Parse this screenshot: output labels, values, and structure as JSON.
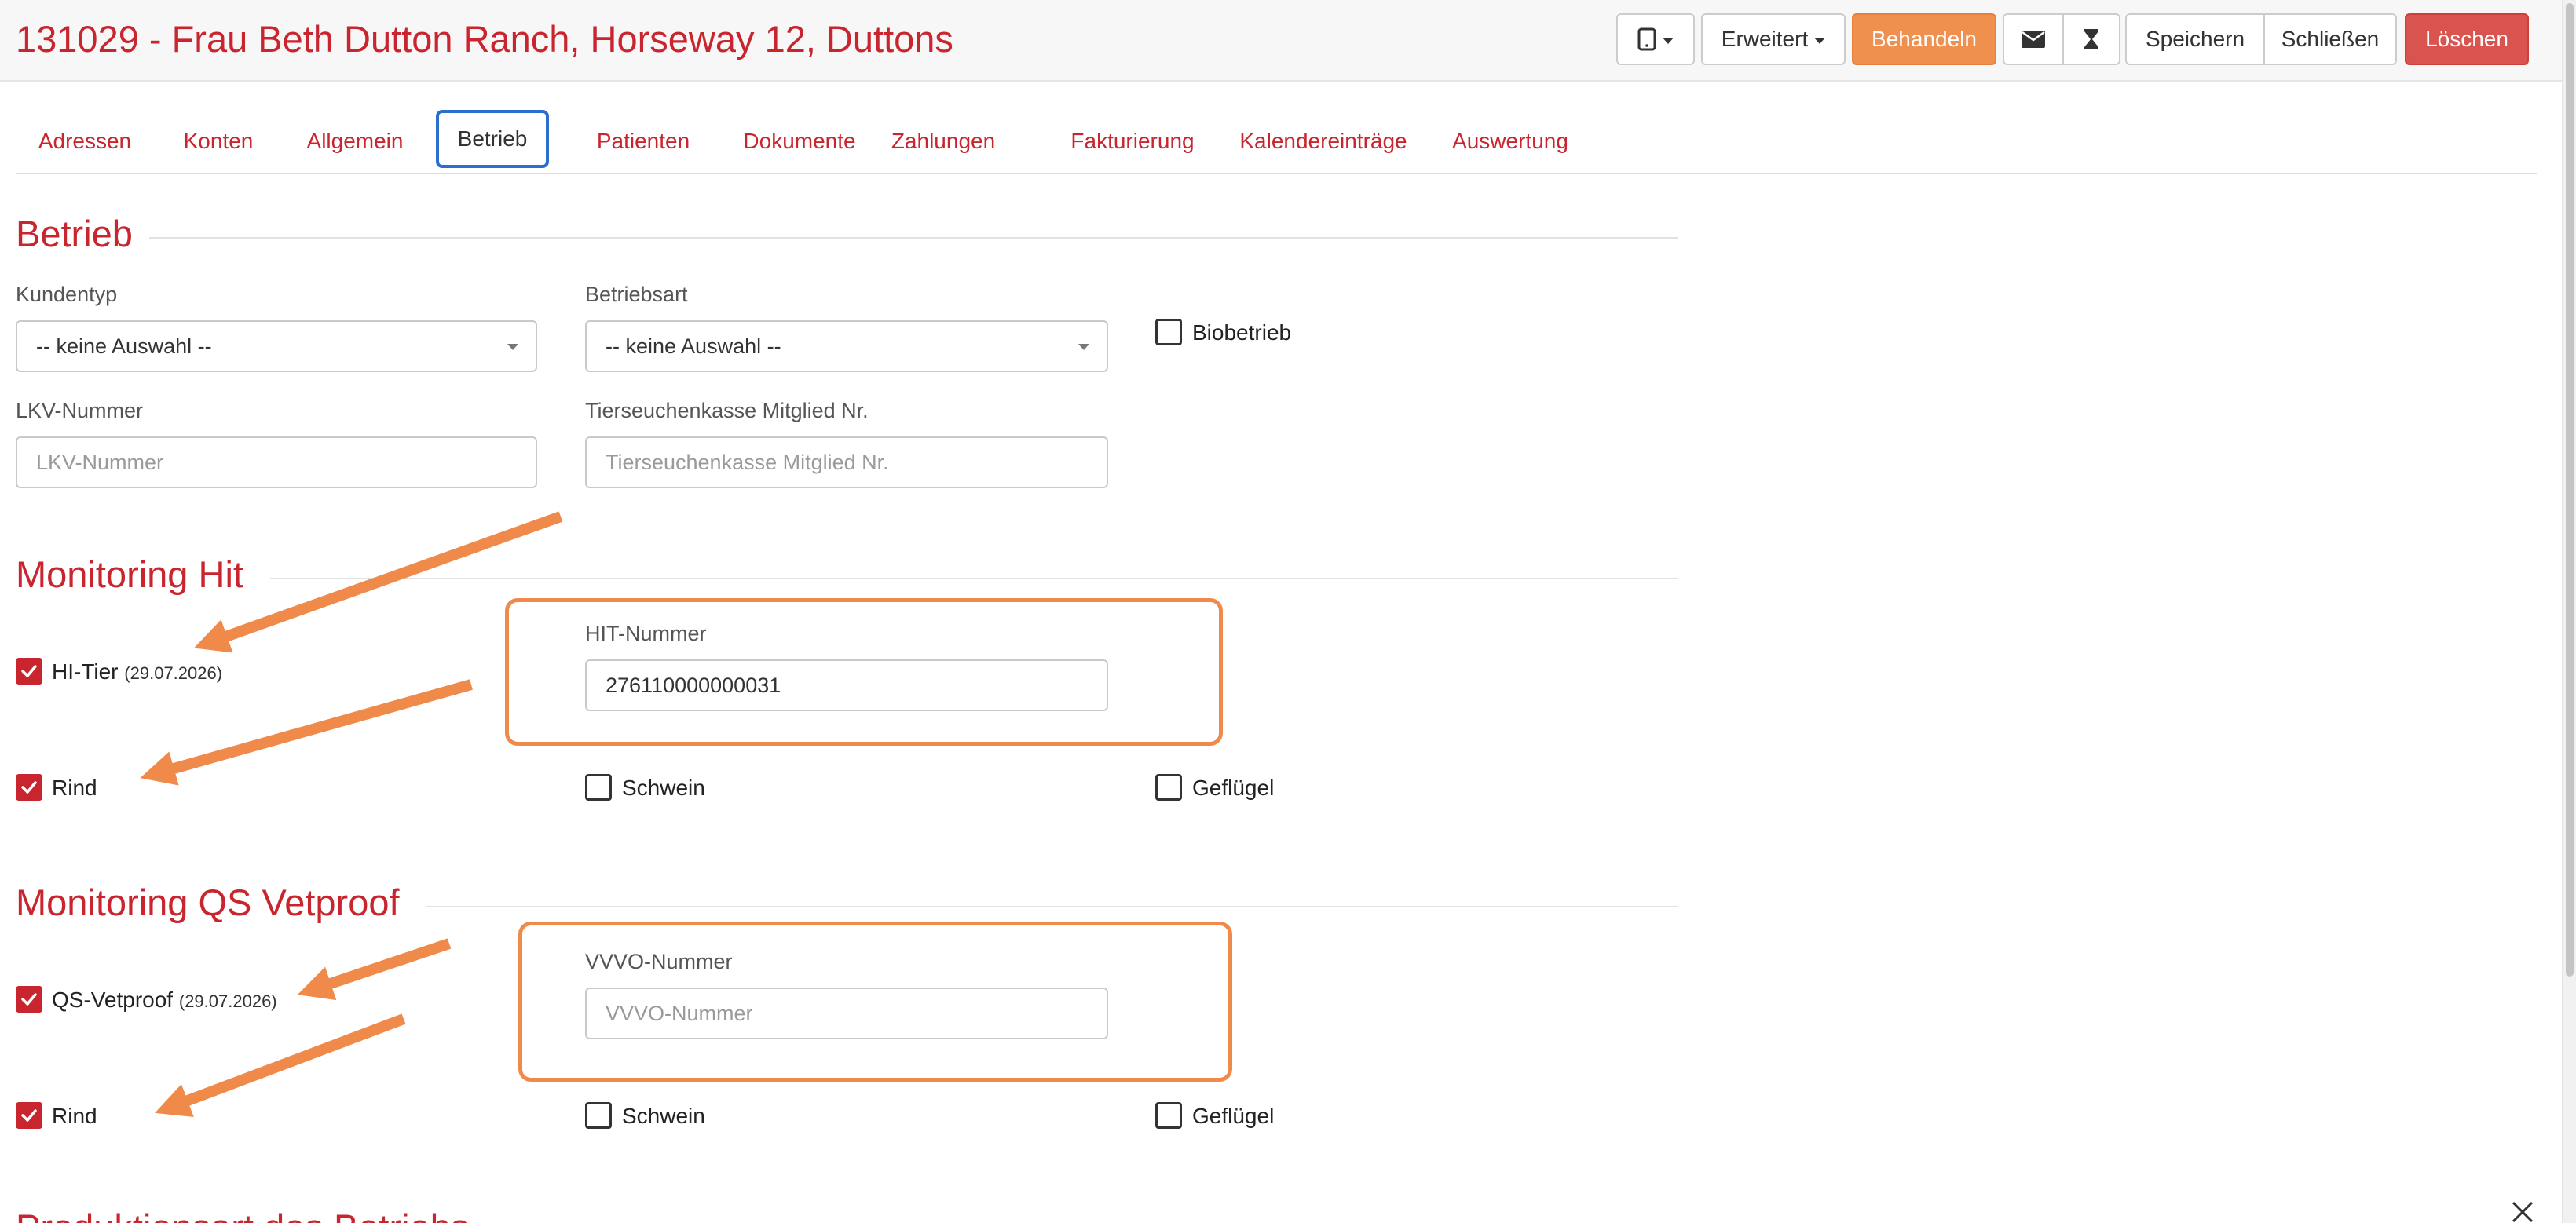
{
  "header": {
    "title": "131029 - Frau Beth Dutton Ranch, Horseway 12, Duttons",
    "buttons": {
      "device_icon": "tablet-icon",
      "erweitert": "Erweitert",
      "behandeln": "Behandeln",
      "mail_icon": "envelope-icon",
      "timer_icon": "hourglass-icon",
      "speichern": "Speichern",
      "schliessen": "Schließen",
      "loeschen": "Löschen"
    }
  },
  "tabs": [
    {
      "label": "Adressen"
    },
    {
      "label": "Konten"
    },
    {
      "label": "Allgemein"
    },
    {
      "label": "Betrieb",
      "active": true
    },
    {
      "label": "Patienten"
    },
    {
      "label": "Dokumente"
    },
    {
      "label": "Zahlungen"
    },
    {
      "label": "Fakturierung"
    },
    {
      "label": "Kalendereinträge"
    },
    {
      "label": "Auswertung"
    }
  ],
  "betrieb": {
    "title": "Betrieb",
    "kundentyp": {
      "label": "Kundentyp",
      "value": "-- keine Auswahl --"
    },
    "betriebsart": {
      "label": "Betriebsart",
      "value": "-- keine Auswahl --"
    },
    "biobetrieb": {
      "label": "Biobetrieb",
      "checked": false
    },
    "lkv": {
      "label": "LKV-Nummer",
      "placeholder": "LKV-Nummer",
      "value": ""
    },
    "tsk": {
      "label": "Tierseuchenkasse Mitglied Nr.",
      "placeholder": "Tierseuchenkasse Mitglied Nr.",
      "value": ""
    }
  },
  "monitoring_hit": {
    "title": "Monitoring Hit",
    "hi_tier": {
      "label": "HI-Tier",
      "date": "(29.07.2026)",
      "checked": true
    },
    "hit_nummer": {
      "label": "HIT-Nummer",
      "value": "276110000000031"
    },
    "rind": {
      "label": "Rind",
      "checked": true
    },
    "schwein": {
      "label": "Schwein",
      "checked": false
    },
    "gefluegel": {
      "label": "Geflügel",
      "checked": false
    }
  },
  "monitoring_qs": {
    "title": "Monitoring QS Vetproof",
    "qs_vetproof": {
      "label": "QS-Vetproof",
      "date": "(29.07.2026)",
      "checked": true
    },
    "vvvo": {
      "label": "VVVO-Nummer",
      "placeholder": "VVVO-Nummer",
      "value": ""
    },
    "rind": {
      "label": "Rind",
      "checked": true
    },
    "schwein": {
      "label": "Schwein",
      "checked": false
    },
    "gefluegel": {
      "label": "Geflügel",
      "checked": false
    }
  },
  "next_section_title": "Produktionsart des Betriebs",
  "colors": {
    "brand_red": "#c9252e",
    "annotation_orange": "#f08a4b",
    "active_tab_border": "#2a6fcd",
    "btn_orange": "#f0904f",
    "btn_red": "#d9534f"
  }
}
